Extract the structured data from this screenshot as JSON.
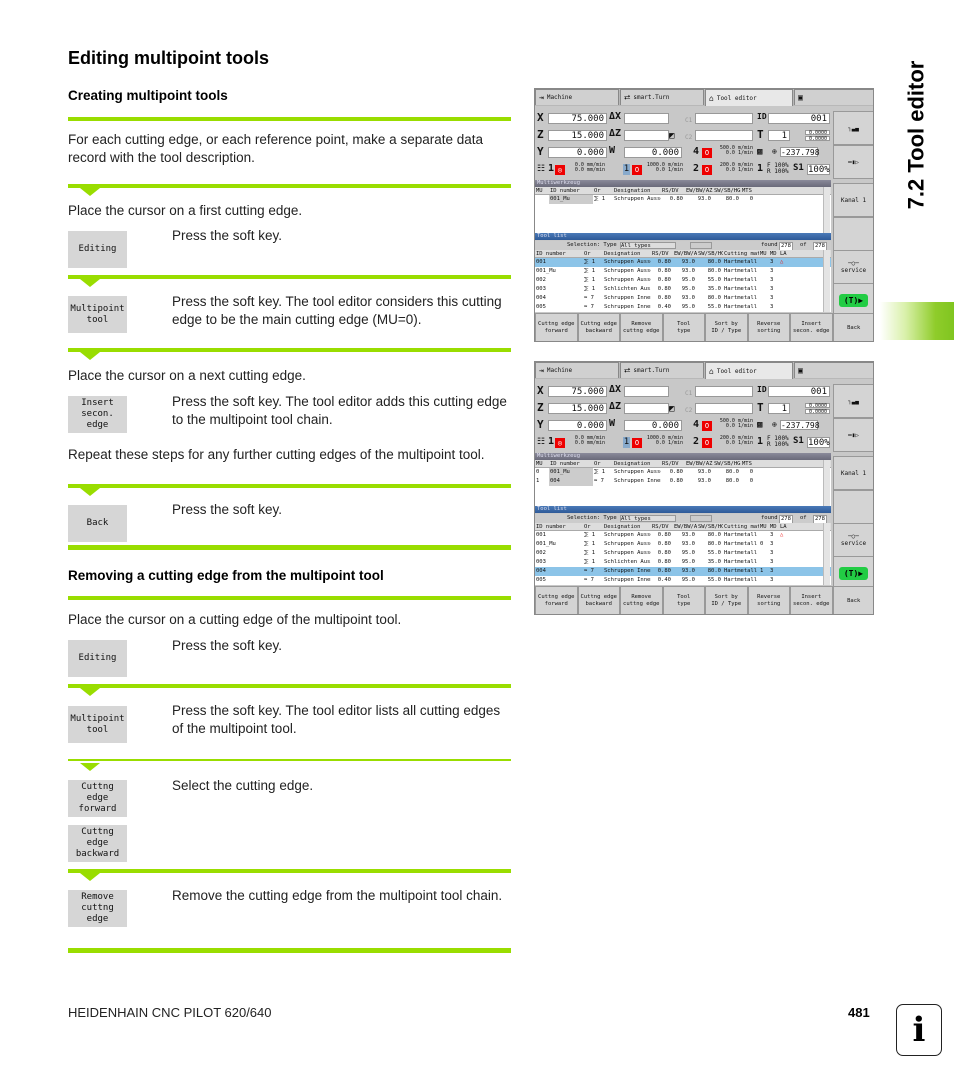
{
  "page": {
    "title": "Editing multipoint tools",
    "section_title": "7.2 Tool editor",
    "footer_left": "HEIDENHAIN CNC PILOT 620/640",
    "page_number": "481",
    "info_icon": "i",
    "accent_color": "#99dd00"
  },
  "creating": {
    "heading": "Creating multipoint tools",
    "intro": "For each cutting edge, or each reference point, make a separate data record with the tool description.",
    "step1": "Place the cursor on a first cutting edge.",
    "sk_editing": "Editing",
    "press_softkey": "Press the soft key.",
    "sk_multipoint": "Multipoint\ntool",
    "multipoint_text": "Press the soft key. The tool editor considers this cutting edge to be the main cutting edge (MU=0).",
    "step_next": "Place the cursor on a next cutting edge.",
    "sk_insert": "Insert\nsecon. edge",
    "insert_text": "Press the soft key. The tool editor adds this cutting edge to the multipoint tool chain.",
    "repeat": "Repeat these steps for any further cutting edges of the multipoint tool.",
    "sk_back": "Back",
    "back_text": "Press the soft key."
  },
  "removing": {
    "heading": "Removing a cutting edge from the multipoint tool",
    "step1": "Place the cursor on a cutting edge of the multipoint tool.",
    "sk_editing": "Editing",
    "editing_text": "Press the soft key.",
    "sk_multipoint": "Multipoint\ntool",
    "multipoint_text": "Press the soft key. The tool editor lists all cutting edges of the multipoint tool.",
    "sk_forward": "Cuttng edge\nforward",
    "sk_backward": "Cuttng edge\nbackward",
    "select_text": "Select the cutting edge.",
    "sk_remove": "Remove\ncuttng edge",
    "remove_text": "Remove the cutting edge from the multipoint tool chain."
  },
  "screen": {
    "tabs": [
      "Machine",
      "smart.Turn",
      "Tool editor",
      ""
    ],
    "x_label": "X",
    "x_value": "75.000",
    "dx_label": "ΔX",
    "z_label": "Z",
    "z_value": "15.000",
    "dz_label": "ΔZ",
    "y_label": "Y",
    "y_value": "0.000",
    "w_label": "W",
    "w_value": "0.000",
    "c1_label": "C1",
    "c2_label": "C2",
    "id_label": "ID",
    "id_value": "001",
    "t_label": "T",
    "t_value": "1",
    "tx_value": "0.0000",
    "tz_value": "0.0000",
    "spindle4": "4",
    "spindle4_speed": "500.0 m/min",
    "spindle4_rpm": "0.0 1/min",
    "angle_value": "-237.798",
    "feed_label": "1",
    "feed1": "0.0 mm/min",
    "feed2": "0.0 mm/min",
    "spindle1": "1",
    "spindle1_speed": "1000.0 m/min",
    "spindle1_rpm": "0.0 1/min",
    "spindle2": "2",
    "spindle2_speed": "200.0 m/min",
    "spindle2_rpm": "0.0 1/min",
    "override_num": "1",
    "f_override": "F 100%",
    "r_override": "R 100%",
    "s1_label": "S1",
    "s1_value": "100%",
    "multitool_title": "Multiwerkzeug",
    "mt_headers": [
      "MU",
      "ID number",
      "Or",
      "Designation",
      "RS/DV",
      "EW/BW/AZ",
      "SW/SB/HG",
      "MTS"
    ],
    "toollist_title": "Tool list",
    "selection_label": "Selection: Type",
    "selection_value": "All types",
    "found_label": "found",
    "found_value": "278",
    "of_label": "of",
    "of_value": "278",
    "tl_headers": [
      "ID number",
      "Or",
      "Designation",
      "RS/DV",
      "EW/BW/AZ",
      "SW/SB/HG",
      "Cutting mat.",
      "MU",
      "MD",
      "LA"
    ],
    "vsoftkeys": [
      "",
      "",
      "Kanal 1",
      "",
      "service",
      "T"
    ],
    "hsoftkeys": [
      "Cuttng edge\nforward",
      "Cuttng edge\nbackward",
      "Remove\ncuttng edge",
      "Tool\ntype",
      "Sort by\nID / Type",
      "Reverse\nsorting",
      "Insert\nsecon. edge",
      "Back"
    ]
  },
  "screen1": {
    "mt_rows": [
      {
        "mu": "",
        "id": "001_Mu",
        "or": "1",
        "des": "Schruppen Aussen",
        "rs": "0.80",
        "ew": "93.0",
        "sw": "80.0",
        "mts": "0"
      }
    ],
    "tl_rows": [
      {
        "id": "001",
        "or": "1",
        "des": "Schruppen Aussen",
        "rs": "0.80",
        "ew": "93.0",
        "sw": "80.0",
        "mat": "Hartmetall",
        "mu": "",
        "md": "3",
        "la": "△",
        "sel": true
      },
      {
        "id": "001_Mu",
        "or": "1",
        "des": "Schruppen Aussen",
        "rs": "0.80",
        "ew": "93.0",
        "sw": "80.0",
        "mat": "Hartmetall",
        "mu": "",
        "md": "3",
        "la": ""
      },
      {
        "id": "002",
        "or": "1",
        "des": "Schruppen Aussen",
        "rs": "0.80",
        "ew": "95.0",
        "sw": "55.0",
        "mat": "Hartmetall",
        "mu": "",
        "md": "3",
        "la": ""
      },
      {
        "id": "003",
        "or": "1",
        "des": "Schlichten Auss…",
        "rs": "0.80",
        "ew": "95.0",
        "sw": "35.0",
        "mat": "Hartmetall",
        "mu": "",
        "md": "3",
        "la": ""
      },
      {
        "id": "004",
        "or": "7",
        "des": "Schruppen Innen",
        "rs": "0.80",
        "ew": "93.0",
        "sw": "80.0",
        "mat": "Hartmetall",
        "mu": "",
        "md": "3",
        "la": ""
      },
      {
        "id": "005",
        "or": "7",
        "des": "Schruppen Innen",
        "rs": "0.40",
        "ew": "95.0",
        "sw": "55.0",
        "mat": "Hartmetall",
        "mu": "",
        "md": "3",
        "la": ""
      }
    ]
  },
  "screen2": {
    "mt_rows": [
      {
        "mu": "0",
        "id": "001_Mu",
        "or": "1",
        "des": "Schruppen Aussen",
        "rs": "0.80",
        "ew": "93.0",
        "sw": "80.0",
        "mts": "0"
      },
      {
        "mu": "1",
        "id": "004",
        "or": "7",
        "des": "Schruppen Innen",
        "rs": "0.80",
        "ew": "93.0",
        "sw": "80.0",
        "mts": "0"
      }
    ],
    "tl_rows": [
      {
        "id": "001",
        "or": "1",
        "des": "Schruppen Aussen",
        "rs": "0.80",
        "ew": "93.0",
        "sw": "80.0",
        "mat": "Hartmetall",
        "mu": "",
        "md": "3",
        "la": "△"
      },
      {
        "id": "001_Mu",
        "or": "1",
        "des": "Schruppen Aussen",
        "rs": "0.80",
        "ew": "93.0",
        "sw": "80.0",
        "mat": "Hartmetall",
        "mu": "0",
        "md": "3",
        "la": ""
      },
      {
        "id": "002",
        "or": "1",
        "des": "Schruppen Aussen",
        "rs": "0.80",
        "ew": "95.0",
        "sw": "55.0",
        "mat": "Hartmetall",
        "mu": "",
        "md": "3",
        "la": ""
      },
      {
        "id": "003",
        "or": "1",
        "des": "Schlichten Auss…",
        "rs": "0.80",
        "ew": "95.0",
        "sw": "35.0",
        "mat": "Hartmetall",
        "mu": "",
        "md": "3",
        "la": ""
      },
      {
        "id": "004",
        "or": "7",
        "des": "Schruppen Innen",
        "rs": "0.80",
        "ew": "93.0",
        "sw": "80.0",
        "mat": "Hartmetall",
        "mu": "1",
        "md": "3",
        "la": "",
        "sel": true
      },
      {
        "id": "005",
        "or": "7",
        "des": "Schruppen Innen",
        "rs": "0.40",
        "ew": "95.0",
        "sw": "55.0",
        "mat": "Hartmetall",
        "mu": "",
        "md": "3",
        "la": ""
      }
    ]
  }
}
